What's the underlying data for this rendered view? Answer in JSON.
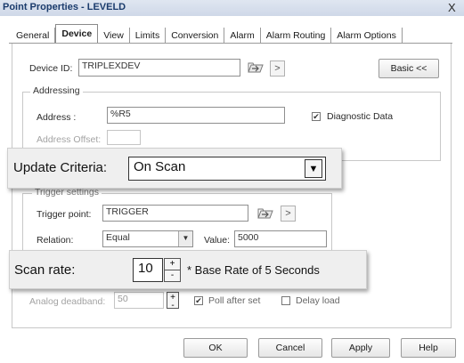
{
  "window": {
    "title": "Point Properties - LEVELD",
    "close_symbol": "X"
  },
  "tabs": [
    {
      "label": "General",
      "active": false
    },
    {
      "label": "Device",
      "active": true
    },
    {
      "label": "View",
      "active": false
    },
    {
      "label": "Limits",
      "active": false
    },
    {
      "label": "Conversion",
      "active": false
    },
    {
      "label": "Alarm",
      "active": false
    },
    {
      "label": "Alarm Routing",
      "active": false
    },
    {
      "label": "Alarm Options",
      "active": false
    }
  ],
  "device": {
    "id_label": "Device ID:",
    "id_value": "TRIPLEXDEV",
    "browse_arrow": ">",
    "basic_button": "Basic <<"
  },
  "addressing": {
    "group_label": "Addressing",
    "address_label": "Address :",
    "address_value": "%R5",
    "diagnostic_label": "Diagnostic Data",
    "diagnostic_checked": true,
    "offset_label": "Address Offset:",
    "offset_value": ""
  },
  "update_criteria": {
    "label": "Update Criteria:",
    "value": "On Scan",
    "arrow": "▼"
  },
  "trigger": {
    "group_label": "Trigger settings",
    "point_label": "Trigger point:",
    "point_value": "TRIGGER",
    "browse_arrow": ">",
    "relation_label": "Relation:",
    "relation_value": "Equal",
    "value_label": "Value:",
    "value_value": "5000"
  },
  "scan_rate": {
    "label": "Scan rate:",
    "value": "10",
    "note": "* Base Rate of 5 Seconds",
    "up": "+",
    "down": "-"
  },
  "bottom_row": {
    "deadband_label": "Analog deadband:",
    "deadband_value": "50",
    "poll_label": "Poll after set",
    "poll_checked": true,
    "delay_label": "Delay load",
    "delay_checked": false
  },
  "buttons": {
    "ok": "OK",
    "cancel": "Cancel",
    "apply": "Apply",
    "help": "Help"
  },
  "icons": {
    "browse": "folder-browse-icon",
    "check": "✔",
    "dropdown": "▼"
  },
  "colors": {
    "title_text": "#1a3b6c",
    "callout_bg": "#efefef"
  }
}
